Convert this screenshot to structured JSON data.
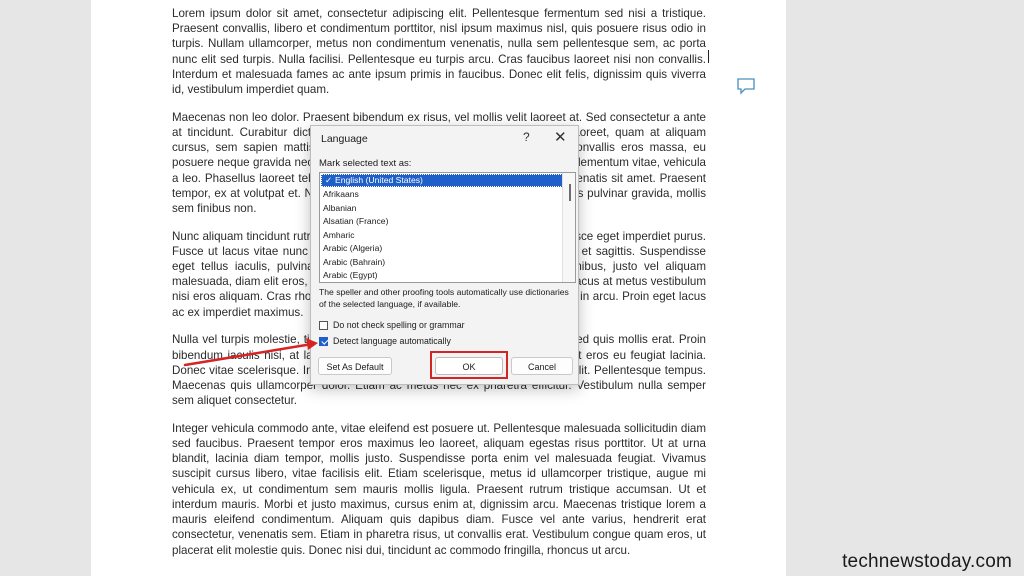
{
  "document": {
    "paragraphs": [
      "Lorem ipsum dolor sit amet, consectetur adipiscing elit. Pellentesque fermentum sed nisi a tristique. Praesent convallis, libero et condimentum porttitor, nisl ipsum maximus nisl, quis posuere risus odio in turpis. Nullam ullamcorper, metus non condimentum venenatis, nulla sem pellentesque sem, ac porta nunc elit sed turpis. Nulla facilisi. Pellentesque eu turpis arcu. Cras faucibus laoreet nisi non convallis. Interdum et malesuada fames ac ante ipsum primis in faucibus. Donec elit felis, dignissim quis viverra id, vestibulum imperdiet quam.",
      "Maecenas non leo dolor. Praesent bibendum ex risus, vel mollis velit laoreet at. Sed consectetur a ante at tincidunt. Curabitur dictum metus ut rutrum pellentesque. Nam feugiat laoreet, quam at aliquam cursus, sem sapien mattis lacus, quis placerat nisl leo et ex. Phasellus convallis eros massa, eu posuere neque gravida nec. Quisque volutpat ligula sem metus, facilisis eget elementum vitae, vehicula a leo. Phasellus laoreet tellus diam rhoncus nisi arcu, ut venenatis augue venenatis sit amet. Praesent tempor, ex at volutpat et. Nullam non lacus id quam convallis dapibus. Vivamus pulvinar gravida, mollis sem finibus non.",
      "Nunc aliquam tincidunt rutrum. Vivamus scelerisque lorem in justo ultricies. Fusce eget imperdiet purus. Fusce ut lacus vitae nunc consequat tincidunt. Maecenas posuere ac mauris et sagittis. Suspendisse eget tellus iaculis, pulvinar leo ut fermentum. Proin ac dictum eros. In finibus, justo vel aliquam malesuada, diam elit eros, non placerat urna sem posuere risus. Phasellus ut lacus at metus vestibulum nisi eros aliquam. Cras rhoncus tempus nisi, a gravida risus porttitor vel. Nunc in arcu. Proin eget lacus ac ex imperdiet maximus.",
      "Nulla vel turpis molestie, tincidunt justo sed, commodo sapien porttitor erat. Sed quis mollis erat. Proin bibendum iaculis nisi, at lacinia felis. Fusce laoreet ornare risus. Nunc aliquet eros eu feugiat lacinia. Donec vitae scelerisque. Integer sed metus ac nunc vestibulum tempus at et elit. Pellentesque tempus. Maecenas quis ullamcorper dolor. Etiam ac metus nec ex pharetra efficitur. Vestibulum nulla semper sem aliquet consectetur.",
      "Integer vehicula commodo ante, vitae eleifend est posuere ut. Pellentesque malesuada sollicitudin diam sed faucibus. Praesent tempor eros maximus leo laoreet, aliquam egestas risus porttitor. Ut at urna blandit, lacinia diam tempor, mollis justo. Suspendisse porta enim vel malesuada feugiat. Vivamus suscipit cursus libero, vitae facilisis elit. Etiam scelerisque, metus id ullamcorper tristique, augue mi vehicula ex, ut condimentum sem mauris mollis ligula. Praesent rutrum tristique accumsan. Ut et interdum mauris. Morbi et justo maximus, cursus enim at, dignissim arcu. Maecenas tristique lorem a mauris eleifend condimentum. Aliquam quis dapibus diam. Fusce vel ante varius, hendrerit erat consectetur, venenatis sem. Etiam in pharetra risus, ut convallis erat. Vestibulum congue quam eros, ut placerat elit molestie quis. Donec nisi dui, tincidunt ac commodo fringilla, rhoncus ut arcu."
    ]
  },
  "dialog": {
    "title": "Language",
    "help": "?",
    "close": "✕",
    "mark_label": "Mark selected text as:",
    "languages": [
      "English (United States)",
      "Afrikaans",
      "Albanian",
      "Alsatian (France)",
      "Amharic",
      "Arabic (Algeria)",
      "Arabic (Bahrain)",
      "Arabic (Egypt)"
    ],
    "selected_language": "English (United States)",
    "description": "The speller and other proofing tools automatically use dictionaries of the selected language, if available.",
    "checkbox_no_check": "Do not check spelling or grammar",
    "checkbox_no_check_value": false,
    "checkbox_detect": "Detect language automatically",
    "checkbox_detect_value": true,
    "set_default_button": "Set As Default",
    "ok_button": "OK",
    "cancel_button": "Cancel"
  },
  "watermark": "technewstoday.com",
  "colors": {
    "highlight": "#d42424",
    "selection": "#1f5fc9"
  }
}
